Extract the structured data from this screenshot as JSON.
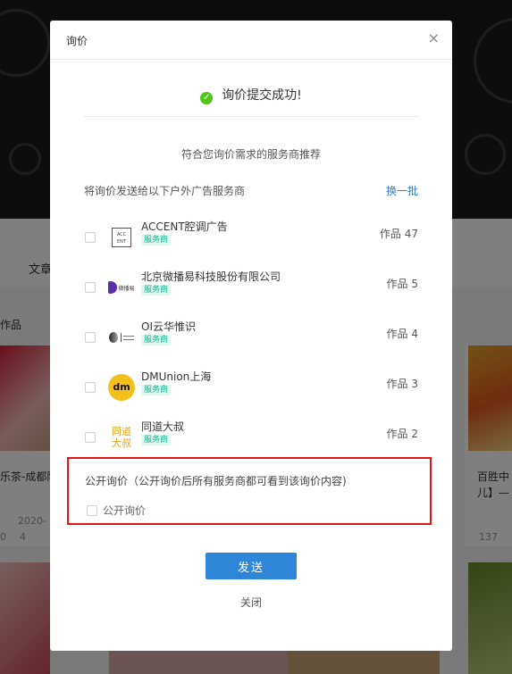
{
  "background": {
    "tab_label": "文章",
    "section_label": "作品",
    "card_left_title": "乐茶-成都阳",
    "card_left_date": "2020-",
    "card_left_views": "0",
    "card_left_likes": "4",
    "card_right_title_1": "百胜中",
    "card_right_title_2": "儿】—",
    "card_right_views": "137"
  },
  "modal": {
    "title": "询价",
    "close_icon": "close-icon",
    "success_message": "询价提交成功!",
    "recommend_text": "符合您询价需求的服务商推荐",
    "list_heading": "将询价发送给以下户外广告服务商",
    "refresh_label": "换一批",
    "providers": [
      {
        "name": "ACCENT腔调广告",
        "tag": "服务商",
        "works": "作品 47",
        "logo": "accent-logo",
        "logo_text": "ACC ENT"
      },
      {
        "name": "北京微播易科技股份有限公司",
        "tag": "服务商",
        "works": "作品 5",
        "logo": "weiboyi-logo",
        "logo_text": "微播易"
      },
      {
        "name": "OI云华惟识",
        "tag": "服务商",
        "works": "作品 4",
        "logo": "oi-logo",
        "logo_text": ""
      },
      {
        "name": "DMUnion上海",
        "tag": "服务商",
        "works": "作品 3",
        "logo": "dmunion-logo",
        "logo_text": "dm"
      },
      {
        "name": "同道大叔",
        "tag": "服务商",
        "works": "作品 2",
        "logo": "tongdao-logo",
        "logo_text": "同道大叔"
      }
    ],
    "public_description": "公开询价（公开询价后所有服务商都可看到该询价内容)",
    "public_label": "公开询价",
    "send_label": "发送",
    "close_label": "关闭"
  },
  "colors": {
    "primary": "#2f86d9",
    "success": "#52c41a",
    "tag": "#1ab394",
    "highlight_border": "#e01616"
  }
}
